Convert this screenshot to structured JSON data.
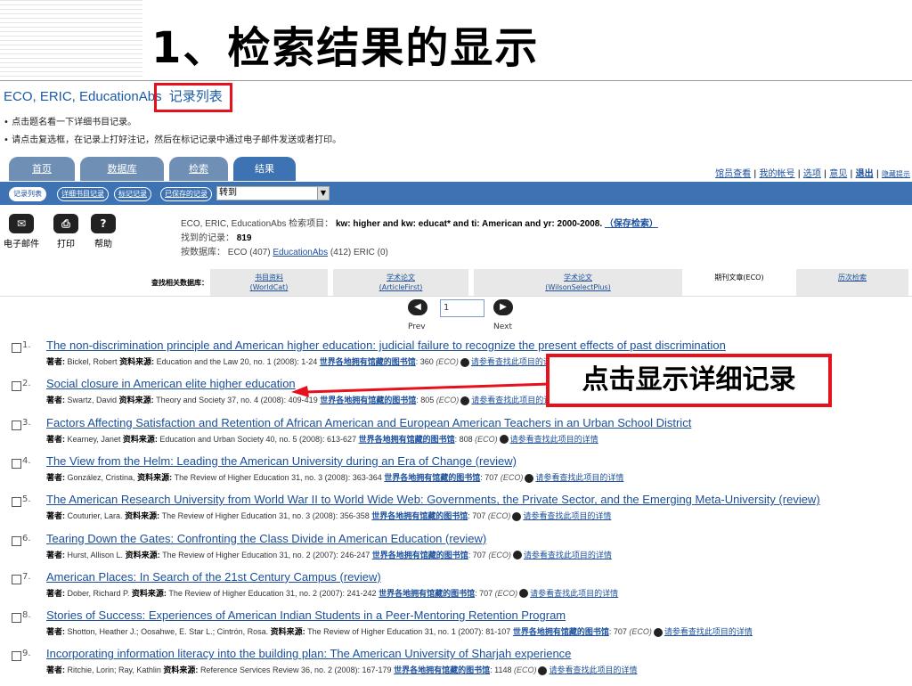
{
  "slide": {
    "title": "1、检索结果的显示"
  },
  "header": {
    "db_title": "ECO, ERIC, EducationAbs",
    "record_list": "记录列表"
  },
  "notes": [
    "点击题名看一下详细书目记录。",
    "请点击复选框，在记录上打好注记，然后在标记记录中通过电子邮件发送或者打印。"
  ],
  "tabs": [
    "首页",
    "数据库",
    "检索",
    "结果"
  ],
  "toplinks": [
    "馆员查看",
    "我的帐号",
    "选项",
    "意见",
    "退出",
    "隐藏提示"
  ],
  "subtabs": [
    "记录列表",
    "详细书目记录",
    "标记记录",
    "已保存的记录"
  ],
  "goto": {
    "value": "转到"
  },
  "tools": [
    "电子邮件",
    "打印",
    "帮助"
  ],
  "search": {
    "line1_prefix": "ECO, ERIC, EducationAbs 检索项目：",
    "query": "kw: higher and kw: educat* and ti: American and yr: 2000-2008.",
    "save_link": "（保存检索）",
    "found_label": "找到的记录：",
    "found_count": "819",
    "by_db_label": "按数据库：",
    "eco": "ECO (407)",
    "educationabs_link": "EducationAbs",
    "educationabs_rest": "(412) ERIC (0)"
  },
  "related": {
    "label": "查找相关数据库：",
    "cols": [
      {
        "t": "书目资料",
        "s": "(WorldCat)"
      },
      {
        "t": "学术论文",
        "s": "(ArticleFirst)"
      },
      {
        "t": "学术论文",
        "s": "(WilsonSelectPlus)"
      },
      {
        "t": "期刊文章",
        "s": "(ECO)"
      },
      {
        "t": "历次检索",
        "s": ""
      }
    ]
  },
  "pager": {
    "page": "1",
    "prev": "Prev",
    "next": "Next"
  },
  "callout": "点击显示详细记录",
  "meta_labels": {
    "author": "著者:",
    "source": "资料来源:",
    "library": "世界各地拥有馆藏的图书馆",
    "detail": "请参看查找此项目的详情"
  },
  "results": [
    {
      "n": "1.",
      "title": "The non-discrimination principle and American higher education: judicial failure to recognize the present effects of past discrimination",
      "author": "Bickel, Robert",
      "source": "Education and the Law 20, no. 1 (2008): 1-24",
      "count": "360"
    },
    {
      "n": "2.",
      "title": "Social closure in American elite higher education",
      "author": "Swartz, David",
      "source": "Theory and Society 37, no. 4 (2008): 409-419",
      "count": "805"
    },
    {
      "n": "3.",
      "title": "Factors Affecting Satisfaction and Retention of African American and European American Teachers in an Urban School District",
      "author": "Kearney, Janet",
      "source": "Education and Urban Society 40, no. 5 (2008): 613-627",
      "count": "808"
    },
    {
      "n": "4.",
      "title": "The View from the Helm: Leading the American University during an Era of Change (review)",
      "author": "González, Cristina,",
      "source": "The Review of Higher Education 31, no. 3 (2008): 363-364",
      "count": "707"
    },
    {
      "n": "5.",
      "title": "The American Research University from World War II to World Wide Web: Governments, the Private Sector, and the Emerging Meta-University (review)",
      "author": "Couturier, Lara.",
      "source": "The Review of Higher Education 31, no. 3 (2008): 356-358",
      "count": "707"
    },
    {
      "n": "6.",
      "title": "Tearing Down the Gates: Confronting the Class Divide in American Education (review)",
      "author": "Hurst, Allison L.",
      "source": "The Review of Higher Education 31, no. 2 (2007): 246-247",
      "count": "707"
    },
    {
      "n": "7.",
      "title": "American Places: In Search of the 21st Century Campus (review)",
      "author": "Dober, Richard P.",
      "source": "The Review of Higher Education 31, no. 2 (2007): 241-242",
      "count": "707"
    },
    {
      "n": "8.",
      "title": "Stories of Success: Experiences of American Indian Students in a Peer-Mentoring Retention Program",
      "author": "Shotton, Heather J.; Oosahwe, E. Star L.; Cintrón, Rosa.",
      "source": "The Review of Higher Education 31, no. 1 (2007): 81-107",
      "count": "707"
    },
    {
      "n": "9.",
      "title": "Incorporating information literacy into the building plan: The American University of Sharjah experience",
      "author": "Ritchie, Lorin; Ray, Kathlin",
      "source": "Reference Services Review 36, no. 2 (2008): 167-179",
      "count": "1148"
    }
  ],
  "colors": {
    "nav_blue": "#3d73b3",
    "link": "#1a4e9a",
    "highlight_red": "#e8101a"
  }
}
